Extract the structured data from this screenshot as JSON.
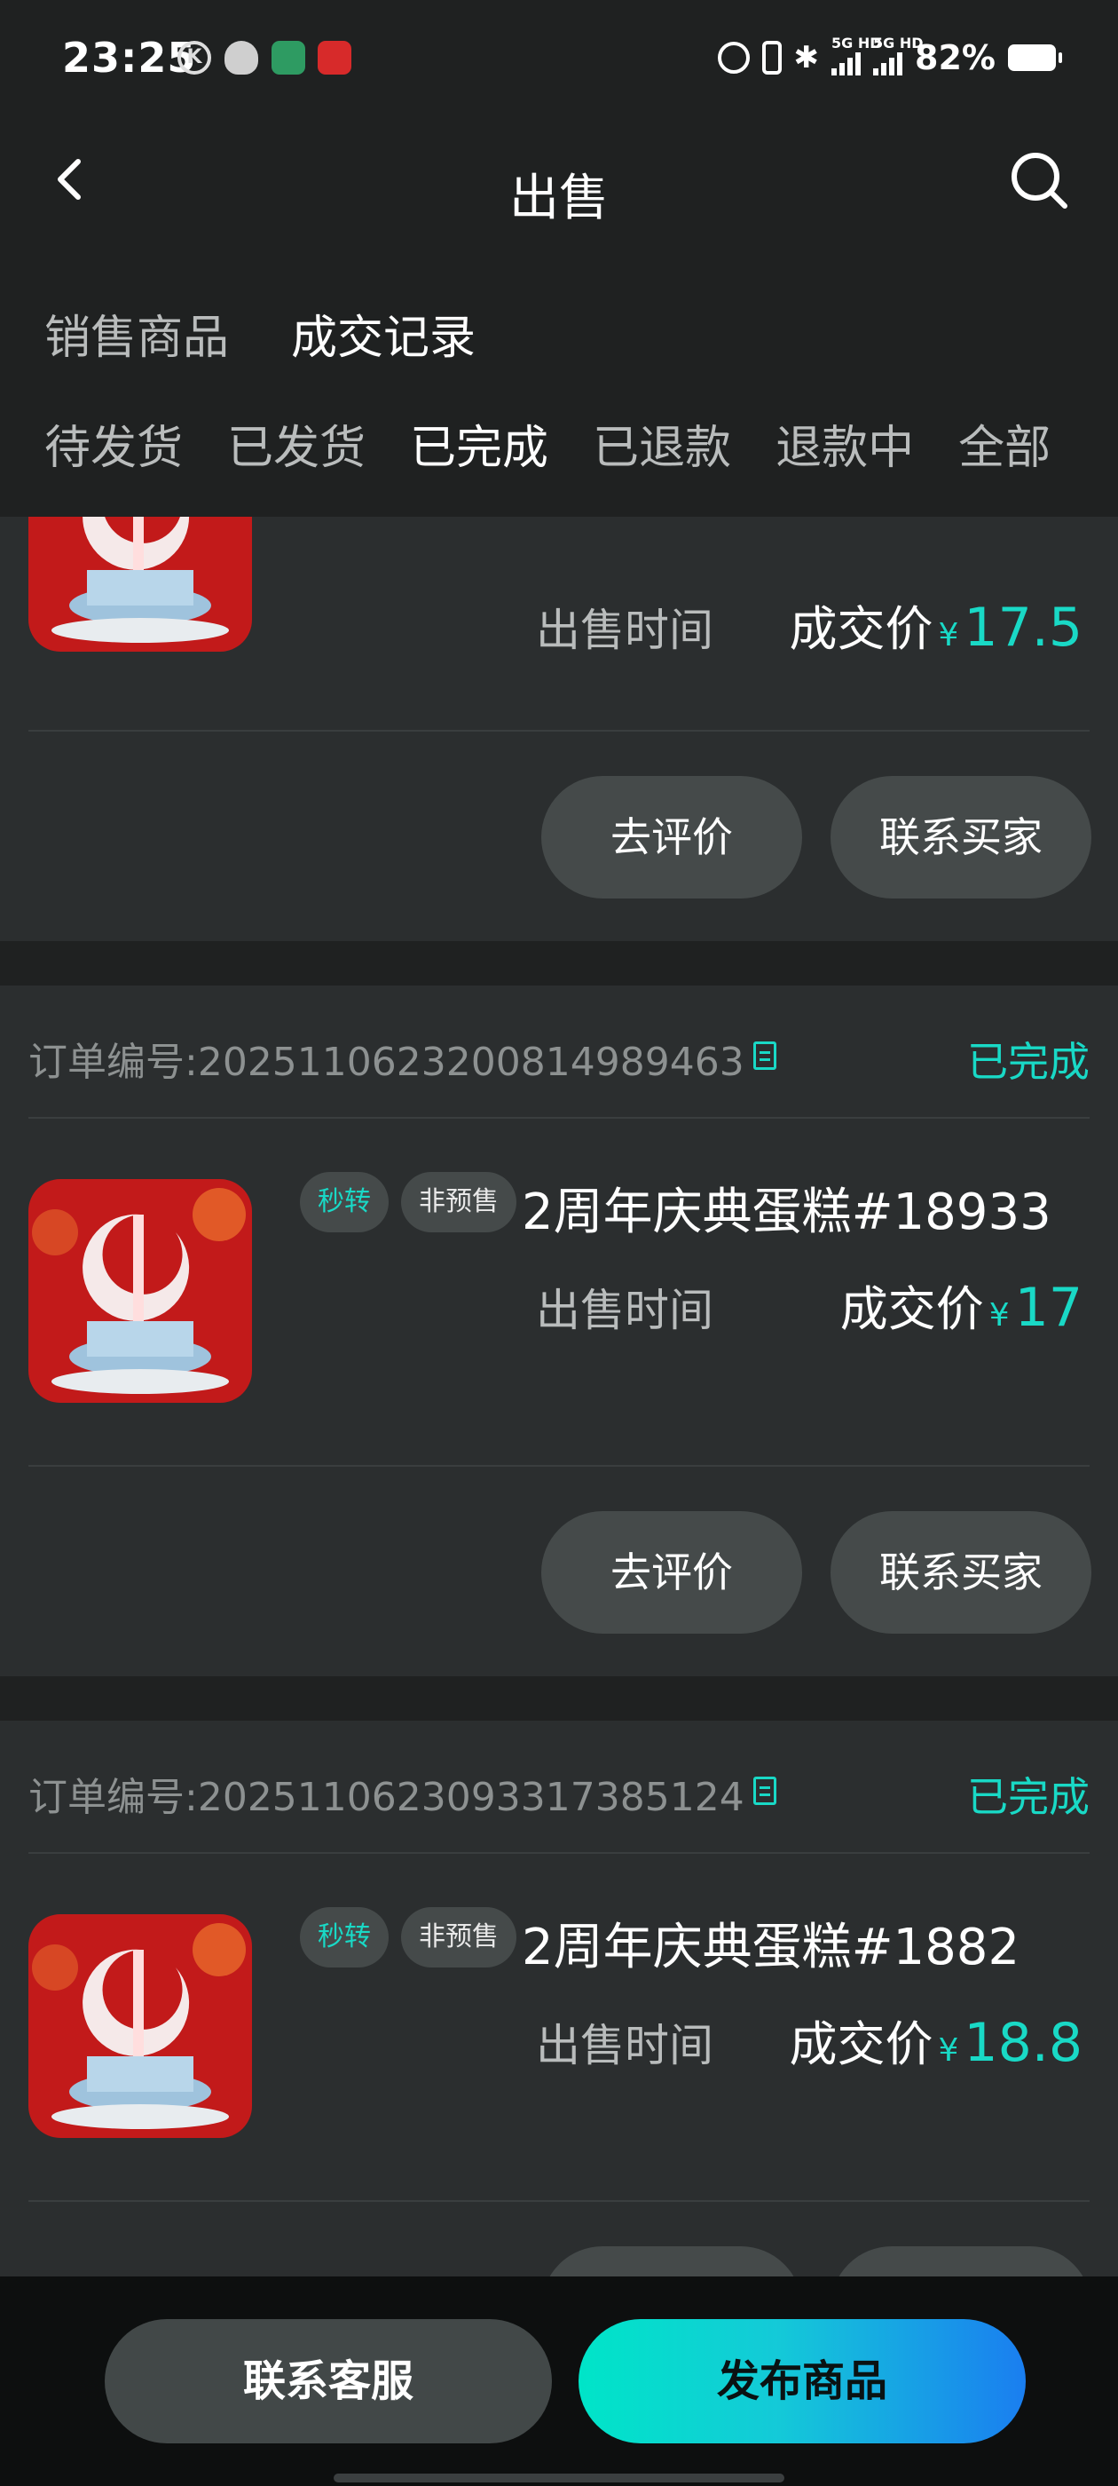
{
  "status_bar": {
    "time": "23:25",
    "k_icon": "K",
    "net1": "5G HD",
    "net2": "5G HD",
    "battery": "82%"
  },
  "nav": {
    "title": "出售"
  },
  "tabs_primary": [
    {
      "label": "销售商品"
    },
    {
      "label": "成交记录"
    }
  ],
  "tabs_secondary": [
    {
      "label": "待发货"
    },
    {
      "label": "已发货"
    },
    {
      "label": "已完成"
    },
    {
      "label": "已退款"
    },
    {
      "label": "退款中"
    },
    {
      "label": "全部"
    }
  ],
  "orders": [
    {
      "sale_time_label": "出售时间",
      "price_label": "成交价",
      "currency": "¥",
      "price": "17.5",
      "review_label": "去评价",
      "contact_label": "联系买家"
    },
    {
      "order_label": "订单编号:",
      "order_no": "2025110623200814989463",
      "status": "已完成",
      "tag_fast": "秒转",
      "tag_pre": "非预售",
      "name": "2周年庆典蛋糕#18933",
      "sale_time_label": "出售时间",
      "price_label": "成交价",
      "currency": "¥",
      "price": "17",
      "review_label": "去评价",
      "contact_label": "联系买家"
    },
    {
      "order_label": "订单编号:",
      "order_no": "2025110623093317385124",
      "status": "已完成",
      "tag_fast": "秒转",
      "tag_pre": "非预售",
      "name": "2周年庆典蛋糕#1882",
      "sale_time_label": "出售时间",
      "price_label": "成交价",
      "currency": "¥",
      "price": "18.8"
    }
  ],
  "bottom": {
    "service_label": "联系客服",
    "publish_label": "发布商品"
  },
  "colors": {
    "accent": "#19d9c6",
    "background": "#1f2121",
    "card": "#2b2e2f",
    "button": "#454a4a"
  }
}
